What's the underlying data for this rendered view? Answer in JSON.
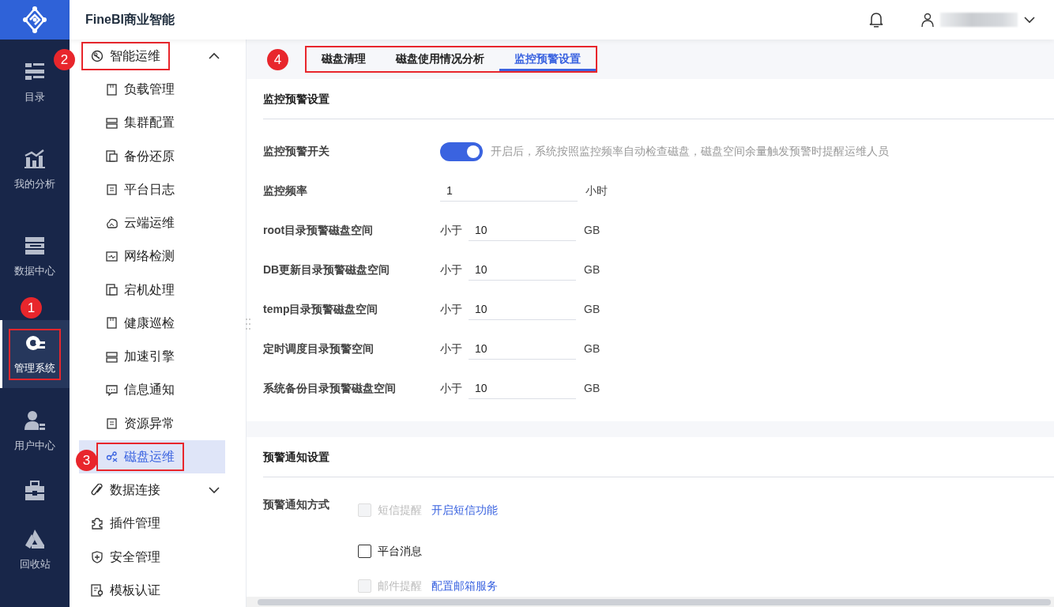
{
  "app": {
    "title": "FineBI商业智能"
  },
  "rail": [
    {
      "label": "目录",
      "selected": false
    },
    {
      "label": "我的分析",
      "selected": false
    },
    {
      "label": "数据中心",
      "selected": false
    },
    {
      "label": "管理系统",
      "selected": true,
      "callout": "1"
    },
    {
      "label": "用户中心",
      "selected": false
    },
    {
      "selected": false
    },
    {
      "label": "回收站",
      "selected": false
    }
  ],
  "nav": [
    {
      "label": "智能运维",
      "expanded": true,
      "callout": "2",
      "children": [
        {
          "label": "负载管理",
          "selected": false
        },
        {
          "label": "集群配置",
          "selected": false
        },
        {
          "label": "备份还原",
          "selected": false
        },
        {
          "label": "平台日志",
          "selected": false
        },
        {
          "label": "云端运维",
          "selected": false
        },
        {
          "label": "网络检测",
          "selected": false
        },
        {
          "label": "宕机处理",
          "selected": false
        },
        {
          "label": "健康巡检",
          "selected": false
        },
        {
          "label": "加速引擎",
          "selected": false
        },
        {
          "label": "信息通知",
          "selected": false
        },
        {
          "label": "资源异常",
          "selected": false
        },
        {
          "label": "磁盘运维",
          "selected": true,
          "callout": "3"
        }
      ]
    },
    {
      "label": "数据连接",
      "expanded": false
    },
    {
      "label": "插件管理"
    },
    {
      "label": "安全管理"
    },
    {
      "label": "模板认证"
    }
  ],
  "tabs_callout": "4",
  "tabs": [
    {
      "label": "磁盘清理",
      "selected": false
    },
    {
      "label": "磁盘使用情况分析",
      "selected": false
    },
    {
      "label": "监控预警设置",
      "selected": true
    }
  ],
  "monitor_section": {
    "title": "监控预警设置",
    "rows": [
      {
        "kind": "switch",
        "label": "监控预警开关",
        "on": true,
        "hint": "开启后，系统按照监控频率自动检查磁盘，磁盘空间余量触发预警时提醒运维人员"
      },
      {
        "kind": "input",
        "label": "监控频率",
        "value": "1",
        "unit": "小时"
      },
      {
        "kind": "threshold",
        "label": "root目录预警磁盘空间",
        "prefix": "小于",
        "value": "10",
        "unit": "GB"
      },
      {
        "kind": "threshold",
        "label": "DB更新目录预警磁盘空间",
        "prefix": "小于",
        "value": "10",
        "unit": "GB"
      },
      {
        "kind": "threshold",
        "label": "temp目录预警磁盘空间",
        "prefix": "小于",
        "value": "10",
        "unit": "GB"
      },
      {
        "kind": "threshold",
        "label": "定时调度目录预警空间",
        "prefix": "小于",
        "value": "10",
        "unit": "GB"
      },
      {
        "kind": "threshold",
        "label": "系统备份目录预警磁盘空间",
        "prefix": "小于",
        "value": "10",
        "unit": "GB"
      }
    ]
  },
  "notify_section": {
    "title": "预警通知设置",
    "label": "预警通知方式",
    "options": [
      {
        "label": "短信提醒",
        "checked": false,
        "disabled": true,
        "link": "开启短信功能"
      },
      {
        "label": "平台消息",
        "checked": false,
        "disabled": false
      },
      {
        "label": "邮件提醒",
        "checked": false,
        "disabled": true,
        "link": "配置邮箱服务"
      }
    ]
  }
}
